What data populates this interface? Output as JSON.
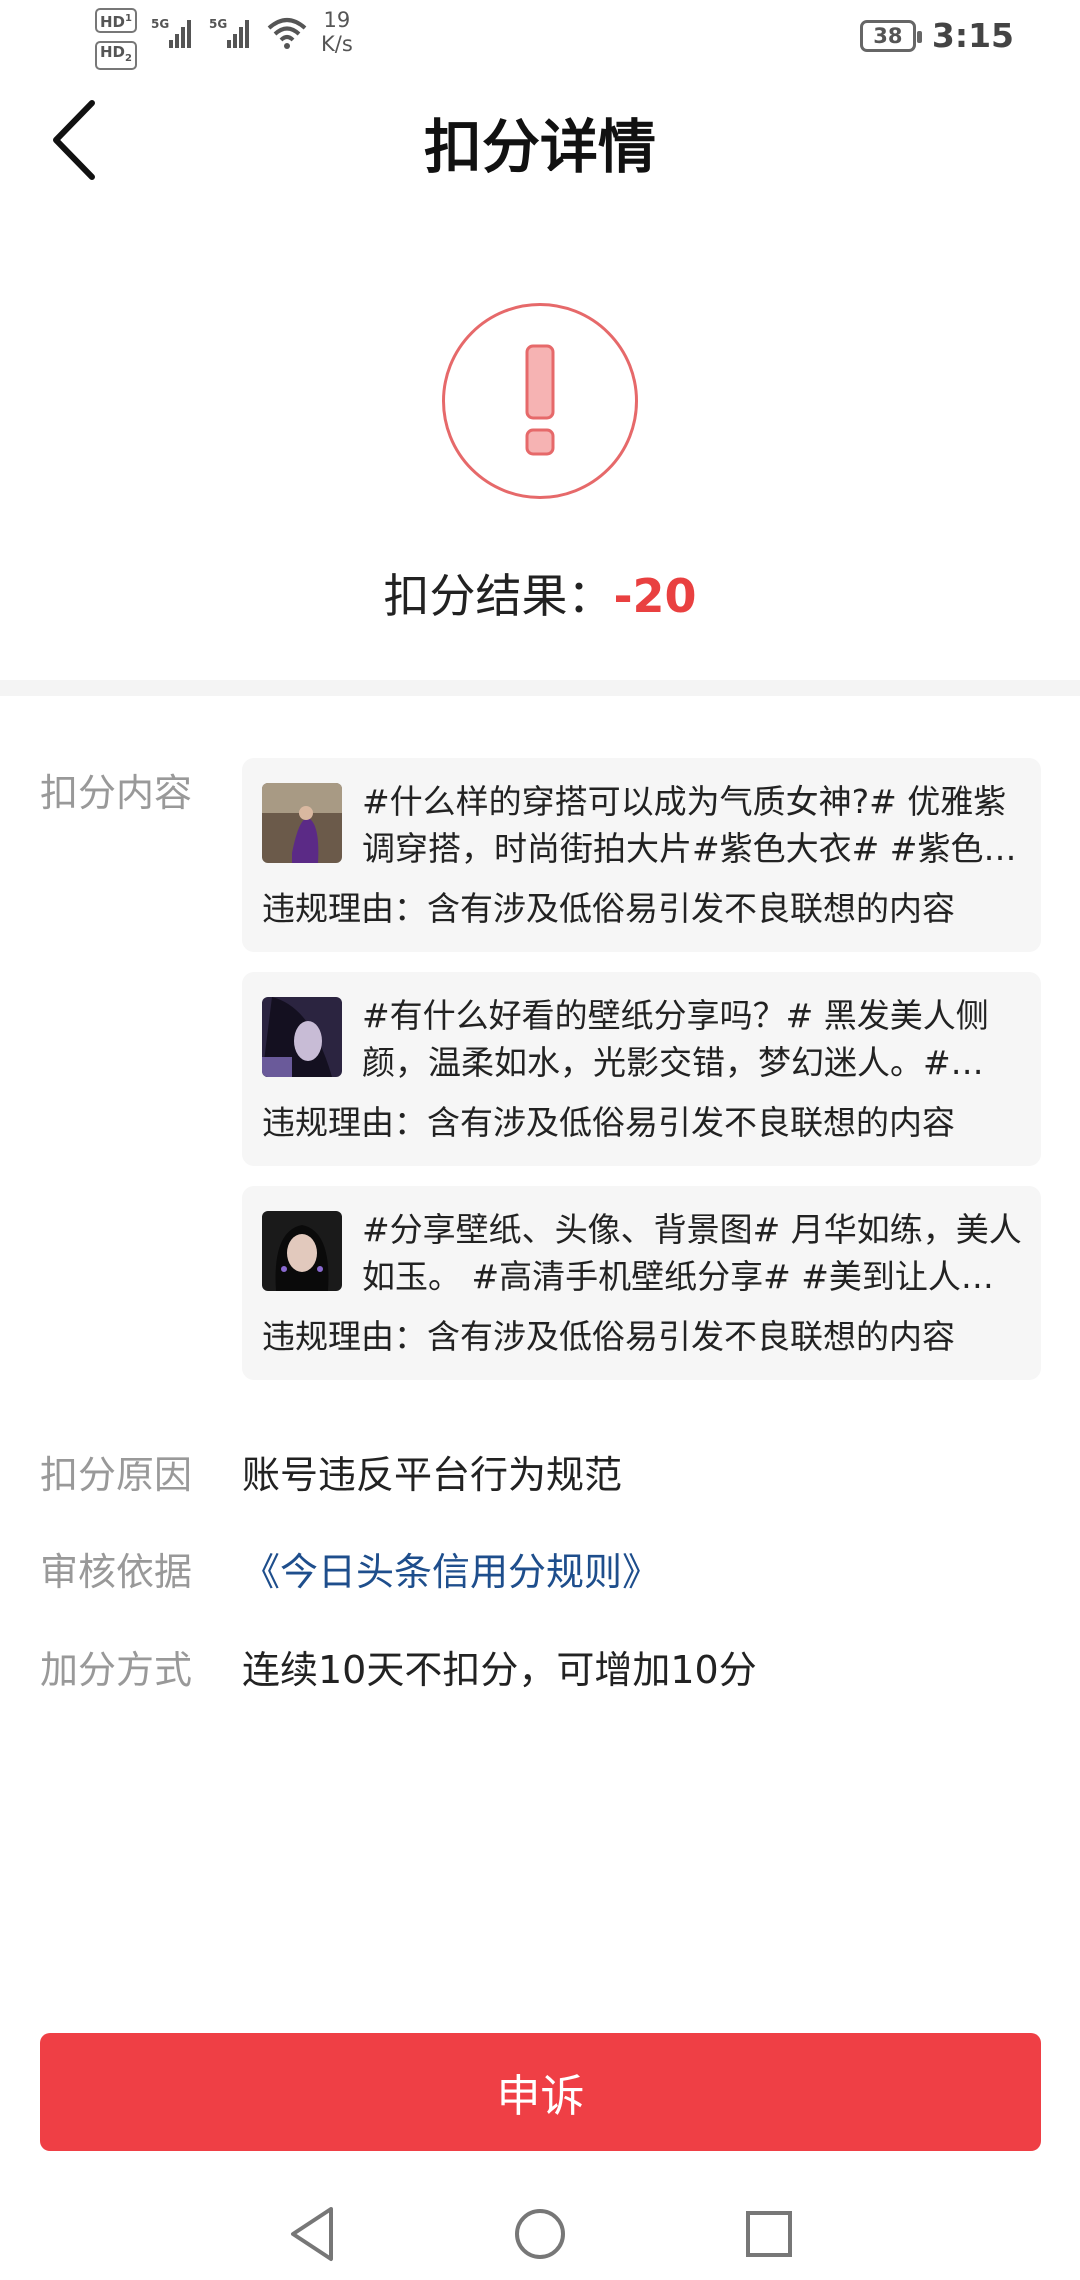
{
  "status_bar": {
    "hd1": "HD",
    "hd1_sub": "1",
    "hd2": "HD",
    "hd2_sub": "2",
    "net1": "5G",
    "net2": "5G",
    "speed_value": "19",
    "speed_unit": "K/s",
    "battery": "38",
    "time": "3:15"
  },
  "header": {
    "title": "扣分详情"
  },
  "result": {
    "label": "扣分结果：",
    "value": "-20",
    "accent_color": "#e94040"
  },
  "details": {
    "content_label": "扣分内容",
    "items": [
      {
        "title": "#什么样的穿搭可以成为气质女神?# 优雅紫调穿搭，时尚街拍大片#紫色大衣# #紫色…",
        "reason": "违规理由：含有涉及低俗易引发不良联想的内容",
        "thumb_icon": "photo-thumbnail"
      },
      {
        "title": "#有什么好看的壁纸分享吗？# 黑发美人侧颜，温柔如水，光影交错，梦幻迷人。#…",
        "reason": "违规理由：含有涉及低俗易引发不良联想的内容",
        "thumb_icon": "photo-thumbnail"
      },
      {
        "title": "#分享壁纸、头像、背景图# 月华如练，美人如玉。 #高清手机壁纸分享# #美到让人…",
        "reason": "违规理由：含有涉及低俗易引发不良联想的内容",
        "thumb_icon": "photo-thumbnail"
      }
    ],
    "reason_label": "扣分原因",
    "reason_value": "账号违反平台行为规范",
    "basis_label": "审核依据",
    "basis_value": "《今日头条信用分规则》",
    "basis_color": "#1e4e8c",
    "bonus_label": "加分方式",
    "bonus_value": "连续10天不扣分，可增加10分"
  },
  "appeal": {
    "label": "申诉",
    "color": "#ef3f45"
  },
  "nav": {
    "back_icon": "triangle-back-icon",
    "home_icon": "circle-home-icon",
    "recents_icon": "square-recents-icon"
  }
}
